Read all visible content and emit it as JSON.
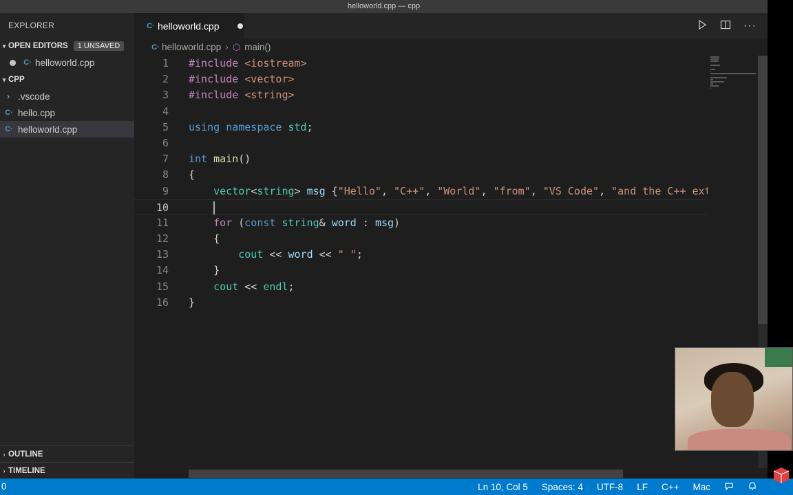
{
  "window": {
    "title": "helloworld.cpp — cpp"
  },
  "sidebar": {
    "title": "EXPLORER",
    "open_editors": {
      "label": "OPEN EDITORS",
      "badge": "1 UNSAVED",
      "files": [
        "helloworld.cpp"
      ]
    },
    "folder": {
      "label": "CPP",
      "items": [
        ".vscode",
        "hello.cpp",
        "helloworld.cpp"
      ]
    },
    "outline": "OUTLINE",
    "timeline": "TIMELINE"
  },
  "tab": {
    "label": "helloworld.cpp"
  },
  "breadcrumb": {
    "file": "helloworld.cpp",
    "symbol": "main()"
  },
  "editor": {
    "lines": [
      "#include <iostream>",
      "#include <vector>",
      "#include <string>",
      "",
      "using namespace std;",
      "",
      "int main()",
      "{",
      "    vector<string> msg {\"Hello\", \"C++\", \"World\", \"from\", \"VS Code\", \"and the C++ extension!\"};",
      "    ",
      "    for (const string& word : msg)",
      "    {",
      "        cout << word << \" \";",
      "    }",
      "    cout << endl;",
      "}"
    ]
  },
  "statusbar": {
    "left": "0",
    "position": "Ln 10, Col 5",
    "spaces": "Spaces: 4",
    "encoding": "UTF-8",
    "eol": "LF",
    "language": "C++",
    "platform": "Mac"
  },
  "colors": {
    "accent": "#007acc",
    "editor_bg": "#1e1e1e",
    "sidebar_bg": "#252526"
  }
}
